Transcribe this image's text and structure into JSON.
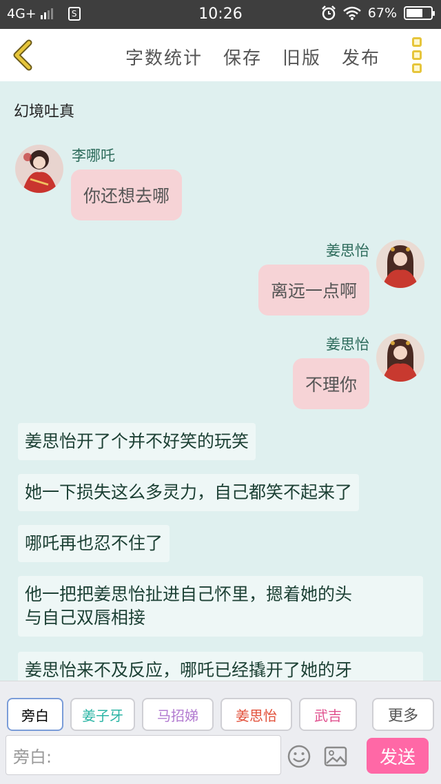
{
  "status_bar": {
    "network": "4G+",
    "sim_icon_letter": "S",
    "time": "10:26",
    "battery": "67%",
    "battery_level": 0.67
  },
  "toolbar": {
    "back_icon": "chevron-left-icon",
    "word_count": "字数统计",
    "save": "保存",
    "old_version": "旧版",
    "publish": "发布",
    "menu_icon": "more-vertical-icon"
  },
  "story": {
    "title": "幻境吐真",
    "messages": [
      {
        "speaker": "李哪吒",
        "text": "你还想去哪",
        "side": "left"
      },
      {
        "speaker": "姜思怡",
        "text": "离远一点啊",
        "side": "right"
      },
      {
        "speaker": "姜思怡",
        "text": "不理你",
        "side": "right"
      }
    ],
    "narrations": [
      "姜思怡开了个并不好笑的玩笑",
      "她一下损失这么多灵力，自己都笑不起来了",
      "哪吒再也忍不住了",
      "他一把把姜思怡扯进自己怀里，摁着她的头",
      "与自己双唇相接",
      "姜思怡来不及反应，哪吒已经撬开了她的牙"
    ]
  },
  "characters": {
    "chips": [
      {
        "label": "旁白",
        "color": "#666666"
      },
      {
        "label": "姜子牙",
        "color": "#2bb5a5"
      },
      {
        "label": "马招娣",
        "color": "#b27ad0"
      },
      {
        "label": "姜思怡",
        "color": "#e2503a"
      },
      {
        "label": "武吉",
        "color": "#e0508e"
      }
    ],
    "more": "更多"
  },
  "composer": {
    "placeholder": "旁白:",
    "emoji_icon": "smiley-icon",
    "image_icon": "image-icon",
    "send": "发送"
  },
  "colors": {
    "background": "#dff0ef",
    "bubble": "#f6d3d6",
    "narration": "#eef7f6",
    "send_button": "#ff68a6",
    "back_chevron": "#e6c53a"
  }
}
